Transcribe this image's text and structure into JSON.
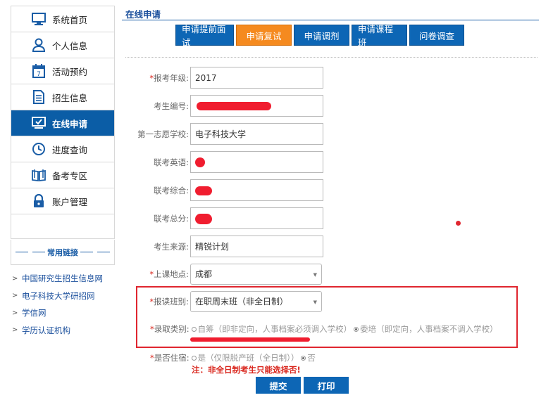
{
  "sidebar": {
    "items": [
      {
        "label": "系统首页",
        "icon": "monitor-icon"
      },
      {
        "label": "个人信息",
        "icon": "user-icon"
      },
      {
        "label": "活动预约",
        "icon": "calendar-icon"
      },
      {
        "label": "招生信息",
        "icon": "document-icon"
      },
      {
        "label": "在线申请",
        "icon": "screen-check-icon",
        "active": true
      },
      {
        "label": "进度查询",
        "icon": "clock-icon"
      },
      {
        "label": "备考专区",
        "icon": "book-icon"
      },
      {
        "label": "账户管理",
        "icon": "lock-icon"
      }
    ],
    "links_title": "常用链接",
    "links": [
      {
        "arrow": ">",
        "label": "中国研究生招生信息网"
      },
      {
        "arrow": ">",
        "label": "电子科技大学研招网"
      },
      {
        "arrow": ">",
        "label": "学信网"
      },
      {
        "arrow": ">",
        "label": "学历认证机构"
      }
    ]
  },
  "main": {
    "title": "在线申请",
    "tabs": [
      {
        "label": "申请提前面试"
      },
      {
        "label": "申请复试",
        "active": true
      },
      {
        "label": "申请调剂"
      },
      {
        "label": "申请课程班"
      },
      {
        "label": "问卷调查"
      }
    ],
    "fields": {
      "year": {
        "required": "*",
        "label": "报考年级:",
        "value": "2017"
      },
      "exam_no": {
        "label": "考生编号:",
        "value": ""
      },
      "first_school": {
        "label": "第一志愿学校:",
        "value": "电子科技大学"
      },
      "english": {
        "label": "联考英语:",
        "value": ""
      },
      "comprehensive": {
        "label": "联考综合:",
        "value": ""
      },
      "total": {
        "label": "联考总分:",
        "value": ""
      },
      "source": {
        "label": "考生来源:",
        "value": "精锐计划"
      },
      "location": {
        "required": "*",
        "label": "上课地点:",
        "value": "成都"
      },
      "class_type": {
        "required": "*",
        "label": "报读班别:",
        "value": "在职周末班（非全日制）"
      },
      "admission": {
        "required": "*",
        "label": "录取类别:",
        "option1": "自筹（即非定向，人事档案必须调入学校）",
        "option2": "委培（即定向，人事档案不调入学校）"
      },
      "lodging": {
        "required": "*",
        "label": "是否住宿:",
        "option1": "是（仅限脱产班（全日制））",
        "option2": "否"
      }
    },
    "note": "注：非全日制考生只能选择否!",
    "submit_label": "提交",
    "print_label": "打印"
  },
  "colors": {
    "primary": "#0d66b5",
    "active_tab": "#f58a1f",
    "alert": "#e0262f"
  }
}
